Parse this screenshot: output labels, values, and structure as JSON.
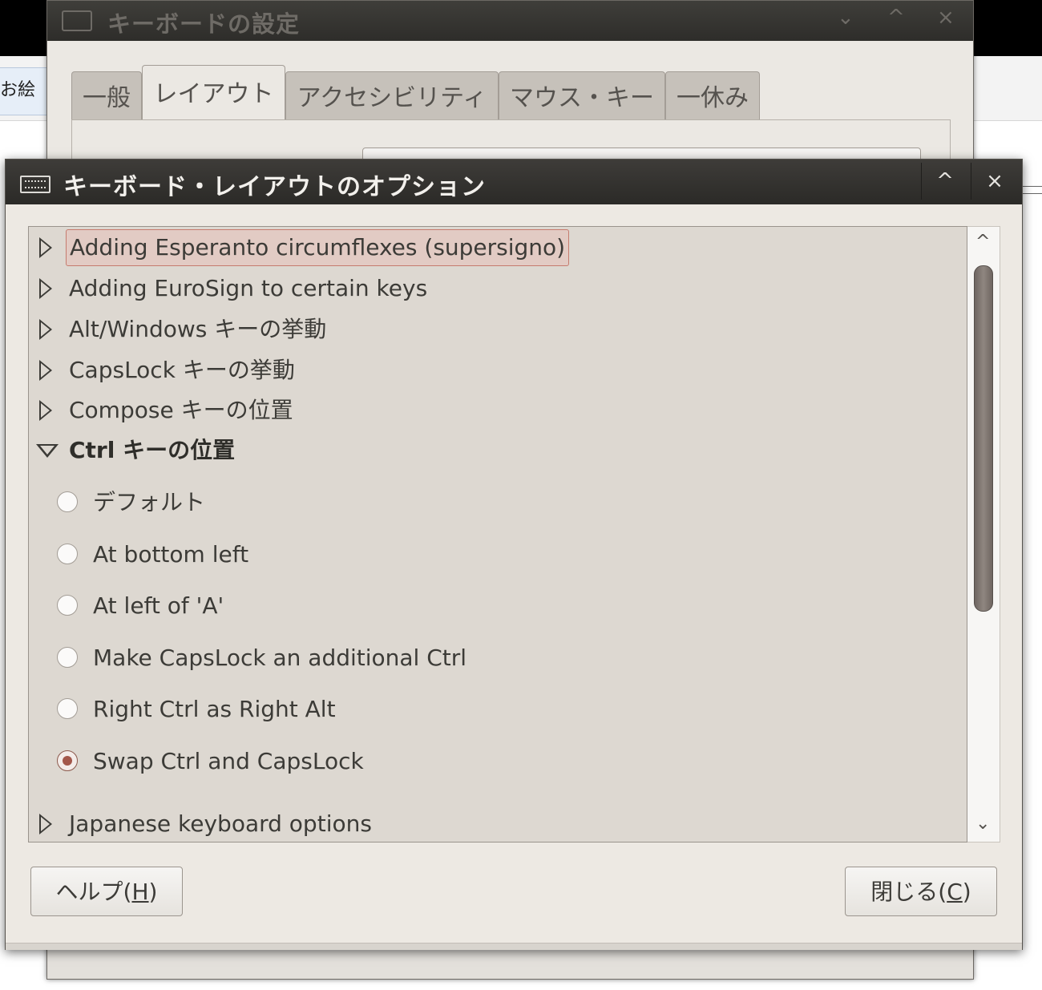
{
  "background": {
    "tab_fragment": "お絵"
  },
  "back_window": {
    "title": "キーボードの設定",
    "controls": {
      "minimize": "⌄",
      "maximize": "^",
      "close": "×"
    },
    "tabs": [
      {
        "label": "一般"
      },
      {
        "label": "レイアウト"
      },
      {
        "label": "アクセシビリティ"
      },
      {
        "label": "マウス・キー"
      },
      {
        "label": "一休み"
      }
    ],
    "active_tab": "レイアウト"
  },
  "dialog": {
    "title": "キーボード・レイアウトのオプション",
    "controls": {
      "maximize": "^",
      "close": "×"
    },
    "options": [
      {
        "label": "Adding Esperanto circumflexes (supersigno)",
        "expanded": false,
        "focused": true
      },
      {
        "label": "Adding EuroSign to certain keys",
        "expanded": false
      },
      {
        "label": "Alt/Windows キーの挙動",
        "expanded": false
      },
      {
        "label": "CapsLock キーの挙動",
        "expanded": false
      },
      {
        "label": "Compose キーの位置",
        "expanded": false
      },
      {
        "label": "Ctrl キーの位置",
        "expanded": true
      },
      {
        "label": "Japanese keyboard options",
        "expanded": false
      }
    ],
    "ctrl_choices": [
      {
        "label": "デフォルト",
        "checked": false
      },
      {
        "label": "At bottom left",
        "checked": false
      },
      {
        "label": "At left of 'A'",
        "checked": false
      },
      {
        "label": "Make CapsLock an additional Ctrl",
        "checked": false
      },
      {
        "label": "Right Ctrl as Right Alt",
        "checked": false
      },
      {
        "label": "Swap Ctrl and CapsLock",
        "checked": true
      }
    ],
    "scrollbar": {
      "up": "^",
      "down": "⌄"
    },
    "buttons": {
      "help_prefix": "ヘルプ(",
      "help_key": "H",
      "help_suffix": ")",
      "close_prefix": "閉じる(",
      "close_key": "C",
      "close_suffix": ")"
    },
    "colors": {
      "titlebar": "#2e2d2a",
      "focus_highlight": "#e2cbc4",
      "radio_checked": "#a3574a",
      "scroll_thumb": "#7a716c"
    }
  }
}
